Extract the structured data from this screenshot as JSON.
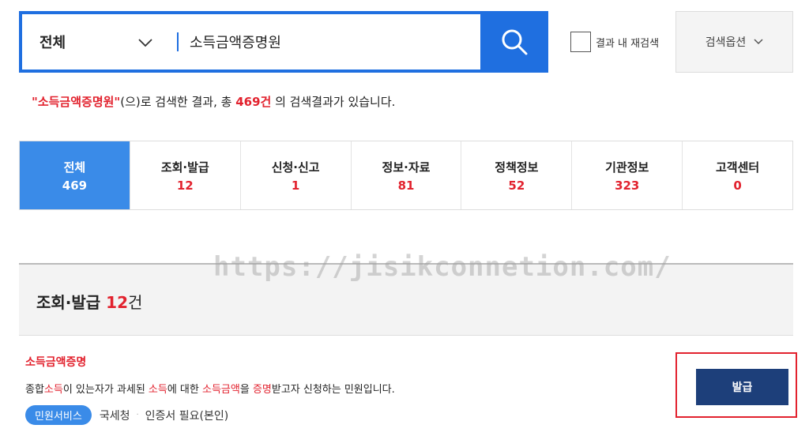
{
  "search": {
    "scope": "전체",
    "query": "소득금액증명원",
    "recheck_label": "결과 내 재검색",
    "options_label": "검색옵션"
  },
  "summary": {
    "quoted_term": "\"소득금액증명원\"",
    "mid": "(으)로 검색한 결과, 총",
    "total": "469건",
    "tail": "의 검색결과가 있습니다."
  },
  "tabs": [
    {
      "label": "전체",
      "count": "469"
    },
    {
      "label": "조회·발급",
      "count": "12"
    },
    {
      "label": "신청·신고",
      "count": "1"
    },
    {
      "label": "정보·자료",
      "count": "81"
    },
    {
      "label": "정책정보",
      "count": "52"
    },
    {
      "label": "기관정보",
      "count": "323"
    },
    {
      "label": "고객센터",
      "count": "0"
    }
  ],
  "section": {
    "title": "조회·발급",
    "count": "12",
    "unit": "건"
  },
  "watermark": "https://jisikconnetion.com/",
  "result": {
    "title": "소득금액증명",
    "desc_parts": [
      "종합",
      "소득",
      "이 있는자가 과세된 ",
      "소득",
      "에 대한 ",
      "소득금액",
      "을 ",
      "증명",
      "받고자 신청하는 민원입니다."
    ],
    "badge": "민원서비스",
    "agency": "국세청",
    "cert": "인증서 필요(본인)",
    "button": "발급"
  },
  "colors": {
    "primary": "#1f6fe0",
    "active_tab": "#3a8be8",
    "highlight": "#e2222e",
    "issue_button": "#1d3f7a"
  }
}
